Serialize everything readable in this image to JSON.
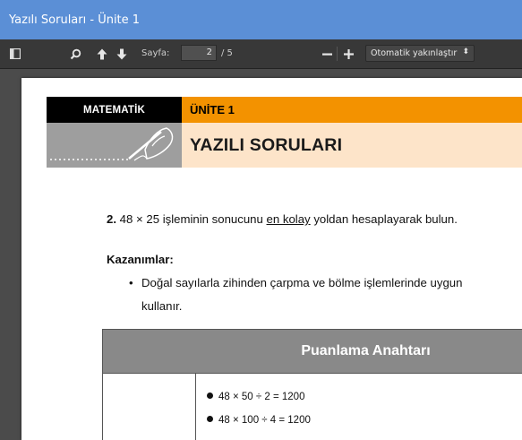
{
  "window": {
    "title": "Yazılı Soruları - Ünite 1"
  },
  "toolbar": {
    "page_label": "Sayfa:",
    "page_current": "2",
    "page_total": "/ 5",
    "zoom_option": "Otomatik yakınlaştır",
    "icons": [
      "sidebar-toggle-icon",
      "search-icon",
      "arrow-up-icon",
      "arrow-down-icon",
      "zoom-out-icon",
      "zoom-in-icon"
    ]
  },
  "document": {
    "subject": "MATEMATİK",
    "unit": "ÜNİTE 1",
    "heading": "YAZILI SORULARI",
    "question_number": "2.",
    "question_before": " 48 × 25 işleminin sonucunu ",
    "question_underlined": "en kolay",
    "question_after": " yoldan hesaplayarak bulun.",
    "kazanimlar_title": "Kazanımlar:",
    "bullet_symbol": "•",
    "kazanim_line1": "Doğal sayılarla zihinden çarpma ve bölme işlemlerinde uygun",
    "kazanim_line2": "kullanır.",
    "table_title": "Puanlama Anahtarı",
    "table_items": [
      "48 × 50 ÷ 2 = 1200",
      "48 × 100 ÷ 4 = 1200"
    ]
  },
  "colors": {
    "titlebar": "#5b8fd6",
    "toolbar": "#383838",
    "viewer_bg": "#4b4b4b",
    "header_black": "#000000",
    "header_orange": "#f39200",
    "header_peach": "#fde4c9",
    "header_gray": "#9e9e9e",
    "table_header": "#898989"
  }
}
